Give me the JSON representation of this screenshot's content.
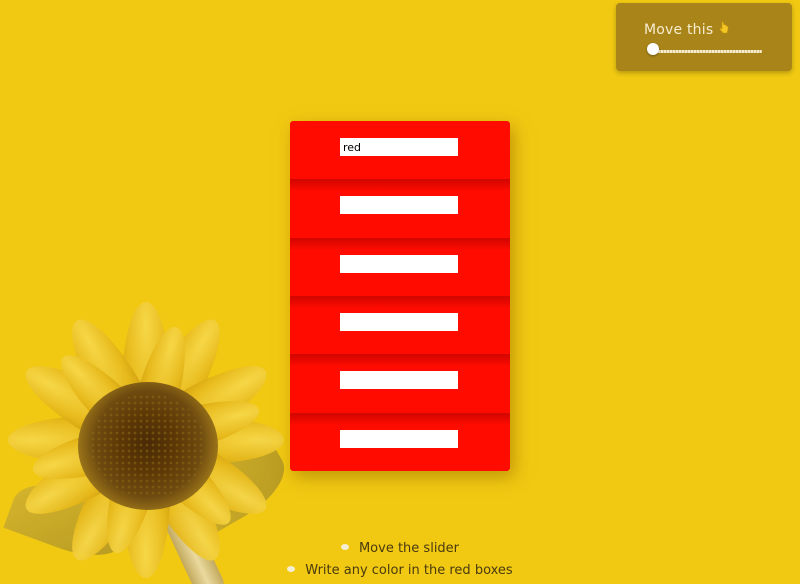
{
  "colors": {
    "background": "#f1c912",
    "panel": "#a88419",
    "box": "#ff0b00"
  },
  "slider_panel": {
    "title": "Move this",
    "icon": "pointing-hand-icon",
    "slider_value": 0
  },
  "color_boxes": [
    {
      "value": "red",
      "placeholder": ""
    },
    {
      "value": "",
      "placeholder": ""
    },
    {
      "value": "",
      "placeholder": ""
    },
    {
      "value": "",
      "placeholder": ""
    },
    {
      "value": "",
      "placeholder": ""
    },
    {
      "value": "",
      "placeholder": ""
    }
  ],
  "instructions": [
    {
      "icon": "bullet-icon",
      "text": "Move the slider"
    },
    {
      "icon": "bullet-icon",
      "text": "Write any color in the red boxes"
    }
  ]
}
